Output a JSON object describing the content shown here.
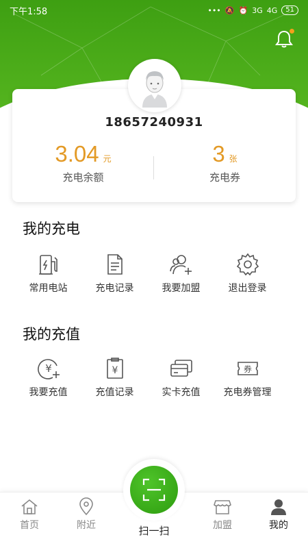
{
  "status_bar": {
    "time": "下午1:58",
    "signal_a": "3G",
    "signal_b": "4G",
    "battery": "51"
  },
  "profile": {
    "phone": "18657240931"
  },
  "balance": {
    "value": "3.04",
    "unit": "元",
    "label": "充电余额"
  },
  "coupons": {
    "value": "3",
    "unit": "张",
    "label": "充电券"
  },
  "charging_section": {
    "title": "我的充电",
    "items": [
      {
        "label": "常用电站",
        "icon": "charging-station-icon"
      },
      {
        "label": "充电记录",
        "icon": "document-icon"
      },
      {
        "label": "我要加盟",
        "icon": "add-user-icon"
      },
      {
        "label": "退出登录",
        "icon": "gear-icon"
      }
    ]
  },
  "topup_section": {
    "title": "我的充值",
    "items": [
      {
        "label": "我要充值",
        "icon": "yen-plus-icon"
      },
      {
        "label": "充值记录",
        "icon": "yen-clipboard-icon"
      },
      {
        "label": "实卡充值",
        "icon": "card-icon"
      },
      {
        "label": "充电券管理",
        "icon": "coupon-icon"
      }
    ],
    "coupon_glyph": "券",
    "yen_glyph": "¥"
  },
  "tabbar": {
    "home": "首页",
    "nearby": "附近",
    "scan": "扫一扫",
    "join": "加盟",
    "mine": "我的"
  },
  "colors": {
    "brand_green": "#4caf1a",
    "accent_orange": "#e39a26"
  }
}
